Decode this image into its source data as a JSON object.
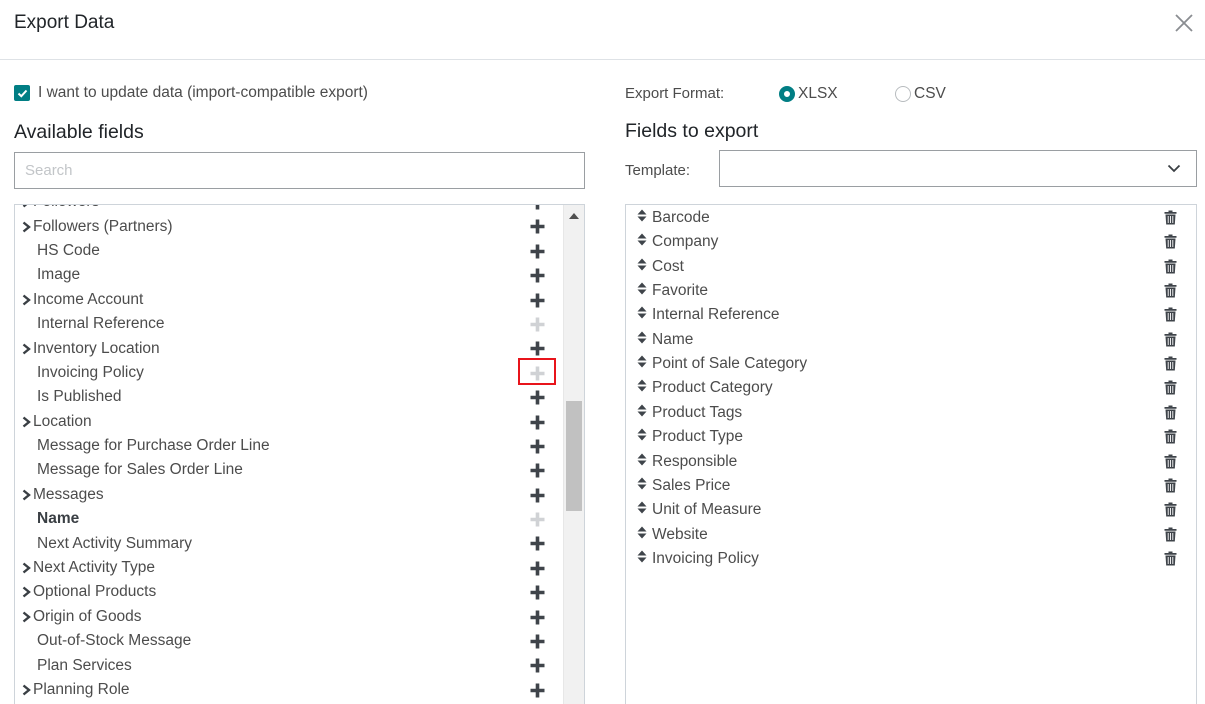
{
  "dialog": {
    "title": "Export Data",
    "close_icon": "close-icon"
  },
  "import_compatible": {
    "label": "I want to update data (import-compatible export)",
    "checked": true,
    "accent_color": "#017e84"
  },
  "available": {
    "title": "Available fields",
    "search_placeholder": "Search",
    "search_value": "",
    "fields": [
      {
        "label": "Followers",
        "expandable": true,
        "addable": true,
        "bold": false
      },
      {
        "label": "Followers (Partners)",
        "expandable": true,
        "addable": true,
        "bold": false
      },
      {
        "label": "HS Code",
        "expandable": false,
        "addable": true,
        "bold": false
      },
      {
        "label": "Image",
        "expandable": false,
        "addable": true,
        "bold": false
      },
      {
        "label": "Income Account",
        "expandable": true,
        "addable": true,
        "bold": false
      },
      {
        "label": "Internal Reference",
        "expandable": false,
        "addable": false,
        "bold": false
      },
      {
        "label": "Inventory Location",
        "expandable": true,
        "addable": true,
        "bold": false
      },
      {
        "label": "Invoicing Policy",
        "expandable": false,
        "addable": false,
        "bold": false,
        "highlighted": true
      },
      {
        "label": "Is Published",
        "expandable": false,
        "addable": true,
        "bold": false
      },
      {
        "label": "Location",
        "expandable": true,
        "addable": true,
        "bold": false
      },
      {
        "label": "Message for Purchase Order Line",
        "expandable": false,
        "addable": true,
        "bold": false
      },
      {
        "label": "Message for Sales Order Line",
        "expandable": false,
        "addable": true,
        "bold": false
      },
      {
        "label": "Messages",
        "expandable": true,
        "addable": true,
        "bold": false
      },
      {
        "label": "Name",
        "expandable": false,
        "addable": false,
        "bold": true
      },
      {
        "label": "Next Activity Summary",
        "expandable": false,
        "addable": true,
        "bold": false
      },
      {
        "label": "Next Activity Type",
        "expandable": true,
        "addable": true,
        "bold": false
      },
      {
        "label": "Optional Products",
        "expandable": true,
        "addable": true,
        "bold": false
      },
      {
        "label": "Origin of Goods",
        "expandable": true,
        "addable": true,
        "bold": false
      },
      {
        "label": "Out-of-Stock Message",
        "expandable": false,
        "addable": true,
        "bold": false
      },
      {
        "label": "Plan Services",
        "expandable": false,
        "addable": true,
        "bold": false
      },
      {
        "label": "Planning Role",
        "expandable": true,
        "addable": true,
        "bold": false
      }
    ]
  },
  "format": {
    "label": "Export Format:",
    "options": [
      {
        "label": "XLSX",
        "checked": true
      },
      {
        "label": "CSV",
        "checked": false
      }
    ]
  },
  "export": {
    "title": "Fields to export",
    "template_label": "Template:",
    "template_value": "",
    "fields": [
      "Barcode",
      "Company",
      "Cost",
      "Favorite",
      "Internal Reference",
      "Name",
      "Point of Sale Category",
      "Product Category",
      "Product Tags",
      "Product Type",
      "Responsible",
      "Sales Price",
      "Unit of Measure",
      "Website",
      "Invoicing Policy"
    ]
  }
}
